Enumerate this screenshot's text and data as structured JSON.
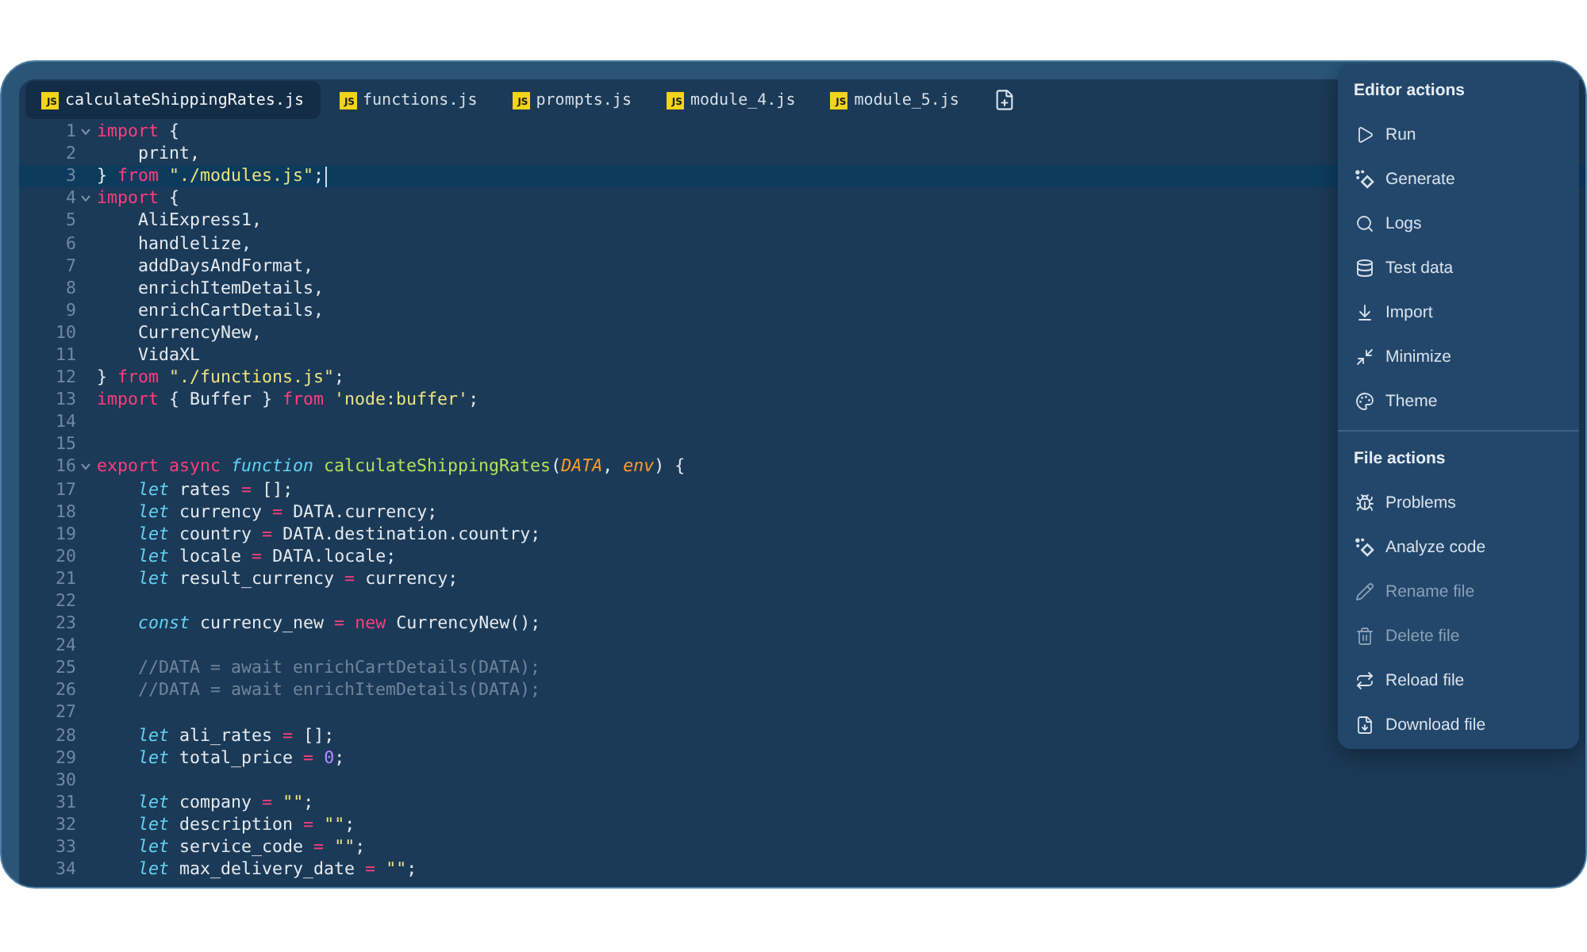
{
  "tabs": [
    {
      "label": "calculateShippingRates.js",
      "tag": "JS",
      "selected": true
    },
    {
      "label": "functions.js",
      "tag": "JS",
      "selected": false
    },
    {
      "label": "prompts.js",
      "tag": "JS",
      "selected": false
    },
    {
      "label": "module_4.js",
      "tag": "JS",
      "selected": false
    },
    {
      "label": "module_5.js",
      "tag": "JS",
      "selected": false
    }
  ],
  "code_lines": [
    {
      "number": "1",
      "foldable": true,
      "current": false,
      "tokens": [
        {
          "kind": "keyword",
          "text": "import"
        },
        {
          "kind": "plain",
          "text": " {"
        }
      ]
    },
    {
      "number": "2",
      "foldable": false,
      "current": false,
      "tokens": [
        {
          "kind": "plain",
          "text": "    print,"
        }
      ]
    },
    {
      "number": "3",
      "foldable": false,
      "current": true,
      "tokens": [
        {
          "kind": "plain",
          "text": "} "
        },
        {
          "kind": "keyword",
          "text": "from "
        },
        {
          "kind": "string",
          "text": "\"./modules.js\""
        },
        {
          "kind": "plain",
          "text": ";"
        }
      ]
    },
    {
      "number": "4",
      "foldable": true,
      "current": false,
      "tokens": [
        {
          "kind": "keyword",
          "text": "import"
        },
        {
          "kind": "plain",
          "text": " {"
        }
      ]
    },
    {
      "number": "5",
      "foldable": false,
      "current": false,
      "tokens": [
        {
          "kind": "plain",
          "text": "    AliExpress1,"
        }
      ]
    },
    {
      "number": "6",
      "foldable": false,
      "current": false,
      "tokens": [
        {
          "kind": "plain",
          "text": "    handlelize,"
        }
      ]
    },
    {
      "number": "7",
      "foldable": false,
      "current": false,
      "tokens": [
        {
          "kind": "plain",
          "text": "    addDaysAndFormat,"
        }
      ]
    },
    {
      "number": "8",
      "foldable": false,
      "current": false,
      "tokens": [
        {
          "kind": "plain",
          "text": "    enrichItemDetails,"
        }
      ]
    },
    {
      "number": "9",
      "foldable": false,
      "current": false,
      "tokens": [
        {
          "kind": "plain",
          "text": "    enrichCartDetails,"
        }
      ]
    },
    {
      "number": "10",
      "foldable": false,
      "current": false,
      "tokens": [
        {
          "kind": "plain",
          "text": "    CurrencyNew,"
        }
      ]
    },
    {
      "number": "11",
      "foldable": false,
      "current": false,
      "tokens": [
        {
          "kind": "plain",
          "text": "    VidaXL"
        }
      ]
    },
    {
      "number": "12",
      "foldable": false,
      "current": false,
      "tokens": [
        {
          "kind": "plain",
          "text": "} "
        },
        {
          "kind": "keyword",
          "text": "from "
        },
        {
          "kind": "string",
          "text": "\"./functions.js\""
        },
        {
          "kind": "plain",
          "text": ";"
        }
      ]
    },
    {
      "number": "13",
      "foldable": false,
      "current": false,
      "tokens": [
        {
          "kind": "keyword",
          "text": "import"
        },
        {
          "kind": "plain",
          "text": " { Buffer } "
        },
        {
          "kind": "keyword",
          "text": "from "
        },
        {
          "kind": "string",
          "text": "'node:buffer'"
        },
        {
          "kind": "plain",
          "text": ";"
        }
      ]
    },
    {
      "number": "14",
      "foldable": false,
      "current": false
    },
    {
      "number": "15",
      "foldable": false,
      "current": false
    },
    {
      "number": "16",
      "foldable": true,
      "current": false,
      "tokens": [
        {
          "kind": "keyword",
          "text": "export "
        },
        {
          "kind": "keyword",
          "text": "async "
        },
        {
          "kind": "storage",
          "text": "function "
        },
        {
          "kind": "function",
          "text": "calculateShippingRates"
        },
        {
          "kind": "plain",
          "text": "("
        },
        {
          "kind": "param",
          "text": "DATA"
        },
        {
          "kind": "plain",
          "text": ", "
        },
        {
          "kind": "param",
          "text": "env"
        },
        {
          "kind": "plain",
          "text": ") {"
        }
      ]
    },
    {
      "number": "17",
      "foldable": false,
      "current": false,
      "tokens": [
        {
          "kind": "storage",
          "text": "    let"
        },
        {
          "kind": "plain",
          "text": " rates "
        },
        {
          "kind": "operator",
          "text": "="
        },
        {
          "kind": "plain",
          "text": " [];"
        }
      ]
    },
    {
      "number": "18",
      "foldable": false,
      "current": false,
      "tokens": [
        {
          "kind": "storage",
          "text": "    let"
        },
        {
          "kind": "plain",
          "text": " currency "
        },
        {
          "kind": "operator",
          "text": "="
        },
        {
          "kind": "plain",
          "text": " DATA.currency;"
        }
      ]
    },
    {
      "number": "19",
      "foldable": false,
      "current": false,
      "tokens": [
        {
          "kind": "storage",
          "text": "    let"
        },
        {
          "kind": "plain",
          "text": " country "
        },
        {
          "kind": "operator",
          "text": "="
        },
        {
          "kind": "plain",
          "text": " DATA.destination.country;"
        }
      ]
    },
    {
      "number": "20",
      "foldable": false,
      "current": false,
      "tokens": [
        {
          "kind": "storage",
          "text": "    let"
        },
        {
          "kind": "plain",
          "text": " locale "
        },
        {
          "kind": "operator",
          "text": "="
        },
        {
          "kind": "plain",
          "text": " DATA.locale;"
        }
      ]
    },
    {
      "number": "21",
      "foldable": false,
      "current": false,
      "tokens": [
        {
          "kind": "storage",
          "text": "    let"
        },
        {
          "kind": "plain",
          "text": " result_currency "
        },
        {
          "kind": "operator",
          "text": "="
        },
        {
          "kind": "plain",
          "text": " currency;"
        }
      ]
    },
    {
      "number": "22",
      "foldable": false,
      "current": false
    },
    {
      "number": "23",
      "foldable": false,
      "current": false,
      "tokens": [
        {
          "kind": "storage",
          "text": "    const"
        },
        {
          "kind": "plain",
          "text": " currency_new "
        },
        {
          "kind": "operator",
          "text": "= "
        },
        {
          "kind": "keyword",
          "text": "new"
        },
        {
          "kind": "plain",
          "text": " CurrencyNew();"
        }
      ]
    },
    {
      "number": "24",
      "foldable": false,
      "current": false
    },
    {
      "number": "25",
      "foldable": false,
      "current": false,
      "tokens": [
        {
          "kind": "comment",
          "text": "    //DATA = await enrichCartDetails(DATA);"
        }
      ]
    },
    {
      "number": "26",
      "foldable": false,
      "current": false,
      "tokens": [
        {
          "kind": "comment",
          "text": "    //DATA = await enrichItemDetails(DATA);"
        }
      ]
    },
    {
      "number": "27",
      "foldable": false,
      "current": false
    },
    {
      "number": "28",
      "foldable": false,
      "current": false,
      "tokens": [
        {
          "kind": "storage",
          "text": "    let"
        },
        {
          "kind": "plain",
          "text": " ali_rates "
        },
        {
          "kind": "operator",
          "text": "="
        },
        {
          "kind": "plain",
          "text": " [];"
        }
      ]
    },
    {
      "number": "29",
      "foldable": false,
      "current": false,
      "tokens": [
        {
          "kind": "storage",
          "text": "    let"
        },
        {
          "kind": "plain",
          "text": " total_price "
        },
        {
          "kind": "operator",
          "text": "= "
        },
        {
          "kind": "number",
          "text": "0"
        },
        {
          "kind": "plain",
          "text": ";"
        }
      ]
    },
    {
      "number": "30",
      "foldable": false,
      "current": false
    },
    {
      "number": "31",
      "foldable": false,
      "current": false,
      "tokens": [
        {
          "kind": "storage",
          "text": "    let"
        },
        {
          "kind": "plain",
          "text": " company "
        },
        {
          "kind": "operator",
          "text": "= "
        },
        {
          "kind": "string",
          "text": "\"\""
        },
        {
          "kind": "plain",
          "text": ";"
        }
      ]
    },
    {
      "number": "32",
      "foldable": false,
      "current": false,
      "tokens": [
        {
          "kind": "storage",
          "text": "    let"
        },
        {
          "kind": "plain",
          "text": " description "
        },
        {
          "kind": "operator",
          "text": "= "
        },
        {
          "kind": "string",
          "text": "\"\""
        },
        {
          "kind": "plain",
          "text": ";"
        }
      ]
    },
    {
      "number": "33",
      "foldable": false,
      "current": false,
      "tokens": [
        {
          "kind": "storage",
          "text": "    let"
        },
        {
          "kind": "plain",
          "text": " service_code "
        },
        {
          "kind": "operator",
          "text": "= "
        },
        {
          "kind": "string",
          "text": "\"\""
        },
        {
          "kind": "plain",
          "text": ";"
        }
      ]
    },
    {
      "number": "34",
      "foldable": false,
      "current": false,
      "tokens": [
        {
          "kind": "storage",
          "text": "    let"
        },
        {
          "kind": "plain",
          "text": " max_delivery_date "
        },
        {
          "kind": "operator",
          "text": "= "
        },
        {
          "kind": "string",
          "text": "\"\""
        },
        {
          "kind": "plain",
          "text": ";"
        }
      ]
    }
  ],
  "menu": {
    "sections": [
      {
        "title": "Editor actions",
        "items": [
          {
            "label": "Run",
            "disabled": false
          },
          {
            "label": "Generate",
            "disabled": false
          },
          {
            "label": "Logs",
            "disabled": false
          },
          {
            "label": "Test data",
            "disabled": false
          },
          {
            "label": "Import",
            "disabled": false
          },
          {
            "label": "Minimize",
            "disabled": false
          },
          {
            "label": "Theme",
            "disabled": false
          }
        ]
      },
      {
        "title": "File actions",
        "items": [
          {
            "label": "Problems",
            "disabled": false
          },
          {
            "label": "Analyze code",
            "disabled": false
          },
          {
            "label": "Rename file",
            "disabled": true
          },
          {
            "label": "Delete file",
            "disabled": true
          },
          {
            "label": "Reload file",
            "disabled": false
          },
          {
            "label": "Download file",
            "disabled": false
          }
        ]
      }
    ]
  }
}
